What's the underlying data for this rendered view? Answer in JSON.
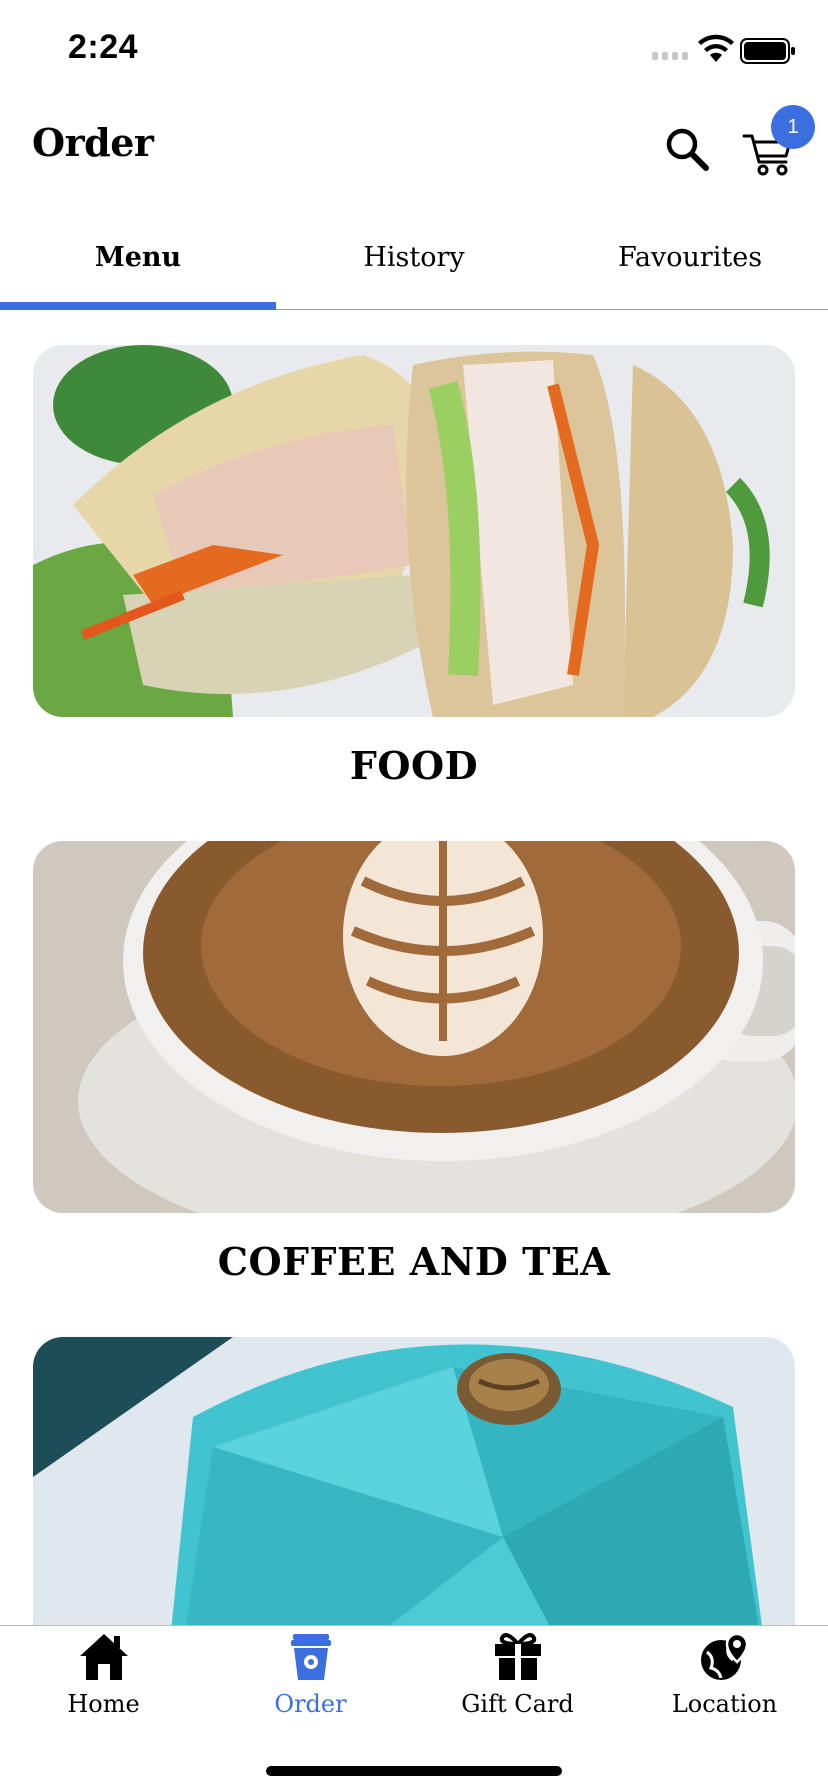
{
  "status_bar": {
    "time": "2:24"
  },
  "header": {
    "title": "Order",
    "cart_count": "1"
  },
  "tabs": [
    {
      "label": "Menu",
      "active": true
    },
    {
      "label": "History",
      "active": false
    },
    {
      "label": "Favourites",
      "active": false
    }
  ],
  "categories": [
    {
      "label": "FOOD",
      "image": "sandwich-photo"
    },
    {
      "label": "COFFEE AND TEA",
      "image": "latte-photo"
    },
    {
      "label": "",
      "image": "dessert-photo"
    }
  ],
  "bottom_nav": [
    {
      "label": "Home",
      "icon": "home-icon",
      "active": false
    },
    {
      "label": "Order",
      "icon": "coffee-cup-icon",
      "active": true
    },
    {
      "label": "Gift Card",
      "icon": "gift-icon",
      "active": false
    },
    {
      "label": "Location",
      "icon": "globe-pin-icon",
      "active": false
    }
  ],
  "colors": {
    "accent": "#3b6fe0",
    "text": "#000000",
    "divider": "#9a9a9a"
  }
}
